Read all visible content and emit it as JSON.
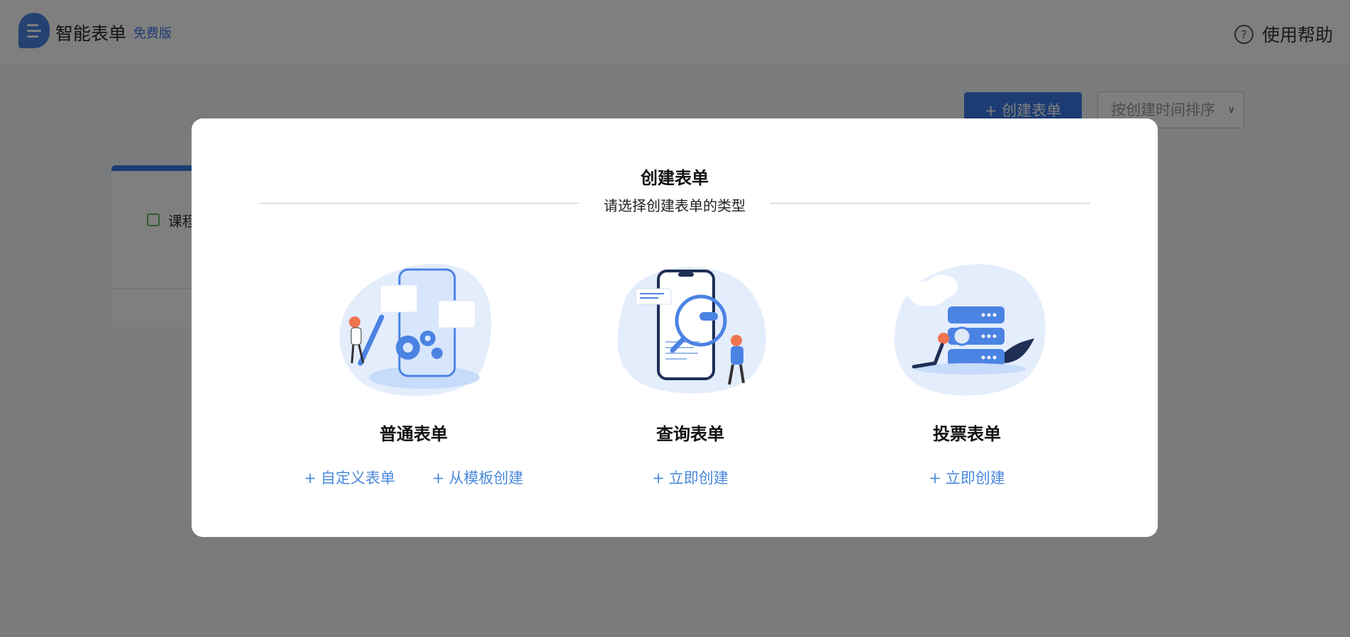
{
  "header": {
    "app_name": "智能表单",
    "edition": "免费版",
    "help_label": "使用帮助",
    "help_icon": "?"
  },
  "toolbar": {
    "create_label": "+ 创建表单",
    "sort_value": "按创建时间排序"
  },
  "form_card": {
    "title": "课程"
  },
  "modal": {
    "title": "创建表单",
    "subtitle": "请选择创建表单的类型",
    "types": [
      {
        "title": "普通表单",
        "links": [
          "自定义表单",
          "从模板创建"
        ]
      },
      {
        "title": "查询表单",
        "links": [
          "立即创建"
        ]
      },
      {
        "title": "投票表单",
        "links": [
          "立即创建"
        ]
      }
    ],
    "link_prefix": "+"
  },
  "colors": {
    "accent": "#3b78e7",
    "link": "#4a89dc",
    "illustration_blob": "#e3edfc",
    "illustration_primary": "#4b83e3",
    "illustration_accent": "#f0734f"
  }
}
